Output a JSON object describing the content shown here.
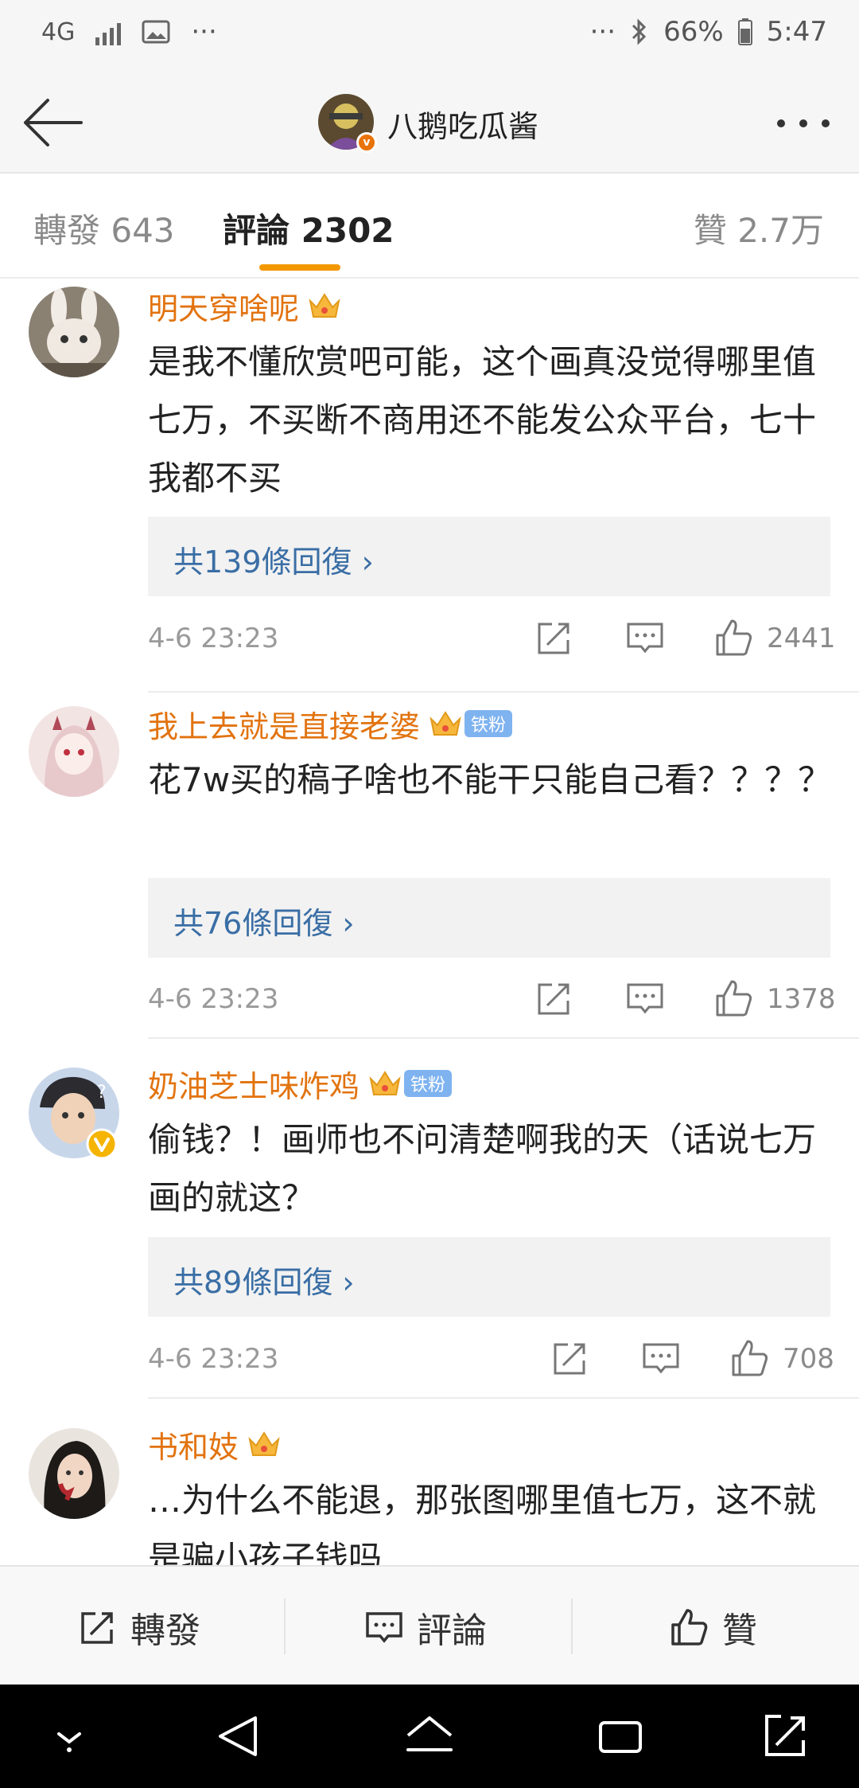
{
  "status_bar": {
    "network": "4G",
    "more": "···",
    "overflow": "···",
    "battery": "66%",
    "time": "5:47"
  },
  "header": {
    "title": "八鹅吃瓜酱",
    "avatar_badge": "v"
  },
  "tabs": {
    "repost": "轉發 643",
    "comments": "評論 2302",
    "likes": "贊 2.7万"
  },
  "comments": [
    {
      "username": "明天穿啥呢",
      "fan_badge": "",
      "text": "是我不懂欣赏吧可能，这个画真没觉得哪里值七万，不买断不商用还不能发公众平台，七十我都不买",
      "replies": "共139條回復 ›",
      "time": "4-6 23:23",
      "likes": "2441"
    },
    {
      "username": "我上去就是直接老婆",
      "fan_badge": "铁粉",
      "text": "花7w买的稿子啥也不能干只能自己看？？？？",
      "replies": "共76條回復 ›",
      "time": "4-6 23:23",
      "likes": "1378"
    },
    {
      "username": "奶油芝士味炸鸡",
      "fan_badge": "铁粉",
      "text": "偷钱？！画师也不问清楚啊我的天（话说七万画的就这？",
      "replies": "共89條回復 ›",
      "time": "4-6 23:23",
      "likes": "708"
    },
    {
      "username": "书和妓",
      "fan_badge": "",
      "text": "…为什么不能退，那张图哪里值七万，这不就是骗小孩子钱吗",
      "replies": "",
      "time": "",
      "likes": ""
    }
  ],
  "bottom_bar": {
    "repost": "轉發",
    "comment": "評論",
    "like": "贊"
  },
  "colors": {
    "username": "#e2730f",
    "reply_link": "#3a6ea5",
    "tab_accent": "#f39800",
    "fan_badge": "#7fb3f0"
  }
}
